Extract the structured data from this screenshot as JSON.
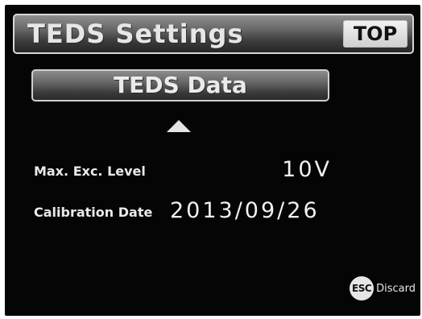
{
  "header": {
    "title": "TEDS Settings",
    "top_button_label": "TOP"
  },
  "main": {
    "data_button_label": "TEDS Data",
    "scroll_up_icon": "triangle-up-icon",
    "fields": [
      {
        "label": "Max. Exc. Level",
        "value": "10V"
      },
      {
        "label": "Calibration Date",
        "value": "2013/09/26"
      }
    ]
  },
  "footer": {
    "esc_badge": "ESC",
    "discard_label": "Discard"
  }
}
